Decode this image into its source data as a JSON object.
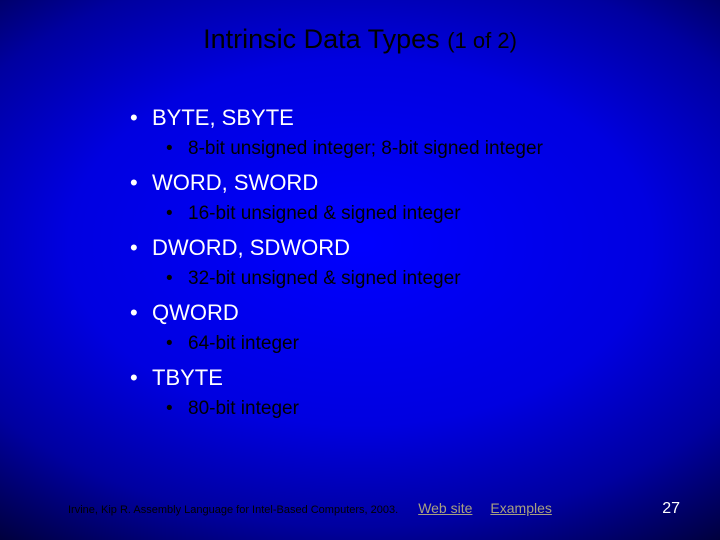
{
  "title": {
    "main": "Intrinsic Data Types",
    "pager": "(1 of 2)"
  },
  "items": [
    {
      "head": "BYTE, SBYTE",
      "sub": "8-bit unsigned integer; 8-bit signed integer"
    },
    {
      "head": "WORD, SWORD",
      "sub": "16-bit unsigned & signed integer"
    },
    {
      "head": "DWORD, SDWORD",
      "sub": "32-bit unsigned & signed integer"
    },
    {
      "head": "QWORD",
      "sub": "64-bit integer"
    },
    {
      "head": "TBYTE",
      "sub": "80-bit integer"
    }
  ],
  "footer": {
    "citation": "Irvine, Kip R. Assembly Language for Intel-Based Computers, 2003.",
    "links": [
      "Web site",
      "Examples"
    ],
    "page": "27"
  }
}
